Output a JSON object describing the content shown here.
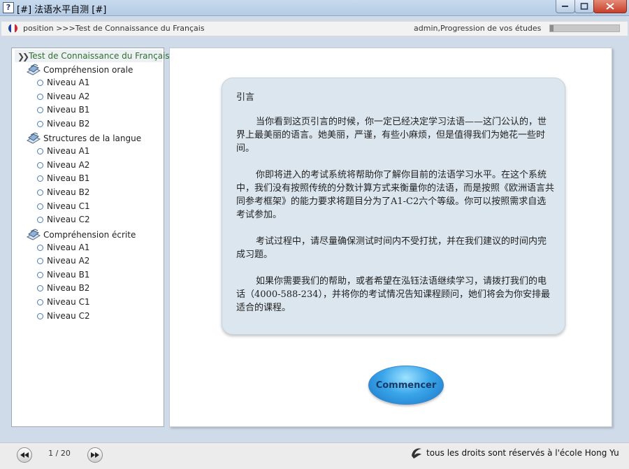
{
  "window": {
    "title": "[#] 法语水平自测 [#]",
    "app_icon": "?"
  },
  "header": {
    "position": "position >>>Test de Connaissance du Français",
    "user_progress_label": "admin,Progression de vos études",
    "progress": 0.05,
    "flag_colors": [
      "#1f3fa0",
      "#ffffff",
      "#d8232a"
    ]
  },
  "sidebar": {
    "root": "Test de Connaissance du Français",
    "sections": [
      {
        "label": "Compréhension orale",
        "levels": [
          "Niveau A1",
          "Niveau A2",
          "Niveau B1",
          "Niveau B2"
        ]
      },
      {
        "label": "Structures de la langue",
        "levels": [
          "Niveau A1",
          "Niveau A2",
          "Niveau B1",
          "Niveau B2",
          "Niveau C1",
          "Niveau C2"
        ]
      },
      {
        "label": "Compréhension écrite",
        "levels": [
          "Niveau A1",
          "Niveau A2",
          "Niveau B1",
          "Niveau B2",
          "Niveau C1",
          "Niveau C2"
        ]
      }
    ]
  },
  "intro": {
    "title": "引言",
    "paragraphs": [
      "当你看到这页引言的时候，你一定已经决定学习法语——这门公认的，世界上最美丽的语言。她美丽，严谨，有些小麻烦，但是值得我们为她花一些时间。",
      "你即将进入的考试系统将帮助你了解你目前的法语学习水平。在这个系统中，我们没有按照传统的分数计算方式来衡量你的法语，而是按照《欧洲语言共同参考框架》的能力要求将题目分为了A1-C2六个等级。你可以按照需求自选考试参加。",
      "考试过程中，请尽量确保测试时间内不受打扰，并在我们建议的时间内完成习题。",
      "如果你需要我们的帮助，或者希望在泓钰法语继续学习，请拨打我们的电话（4000-588-234），并将你的考试情况告知课程顾问，她们将会为你安排最适合的课程。"
    ]
  },
  "start_button": {
    "label": "Commencer"
  },
  "footer": {
    "page_indicator": "1 / 20",
    "copyright": "tous les droits sont réservés à l'école Hong Yu"
  },
  "icons": {
    "prev": "prev-page-icon",
    "next": "next-page-icon",
    "section": "books-icon",
    "root": "double-chevron-right-icon",
    "logo": "school-logo-icon"
  }
}
